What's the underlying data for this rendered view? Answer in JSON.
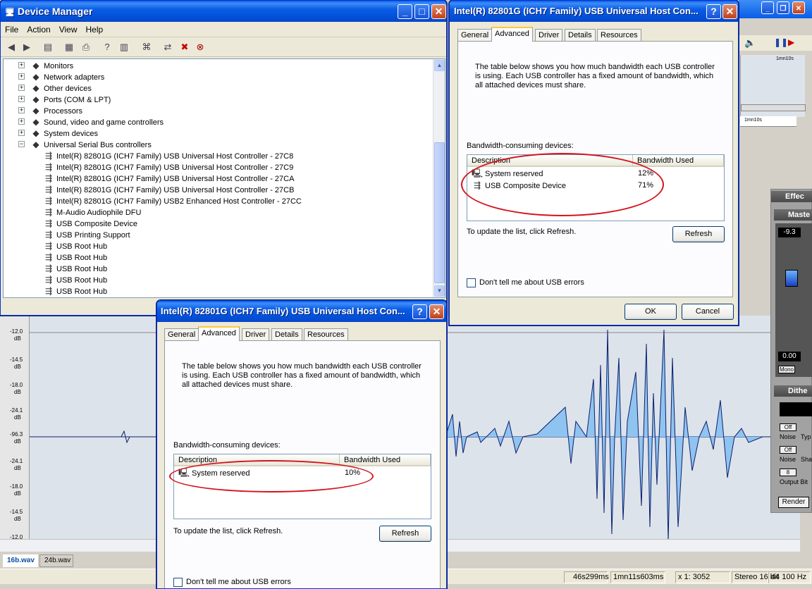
{
  "device_manager": {
    "title": "Device Manager",
    "menu": [
      "File",
      "Action",
      "View",
      "Help"
    ],
    "tree": [
      {
        "label": "Monitors",
        "icon": "monitor-icon",
        "expander": "+"
      },
      {
        "label": "Network adapters",
        "icon": "network-icon",
        "expander": "+"
      },
      {
        "label": "Other devices",
        "icon": "question-icon",
        "expander": "+"
      },
      {
        "label": "Ports (COM & LPT)",
        "icon": "port-icon",
        "expander": "+"
      },
      {
        "label": "Processors",
        "icon": "chip-icon",
        "expander": "+"
      },
      {
        "label": "Sound, video and game controllers",
        "icon": "speaker-icon",
        "expander": "+"
      },
      {
        "label": "System devices",
        "icon": "computer-icon",
        "expander": "+"
      },
      {
        "label": "Universal Serial Bus controllers",
        "icon": "usb-icon",
        "expander": "−"
      }
    ],
    "usb_children": [
      "Intel(R) 82801G (ICH7 Family) USB Universal Host Controller - 27C8",
      "Intel(R) 82801G (ICH7 Family) USB Universal Host Controller - 27C9",
      "Intel(R) 82801G (ICH7 Family) USB Universal Host Controller - 27CA",
      "Intel(R) 82801G (ICH7 Family) USB Universal Host Controller - 27CB",
      "Intel(R) 82801G (ICH7 Family) USB2 Enhanced Host Controller - 27CC",
      "M-Audio Audiophile DFU",
      "USB Composite Device",
      "USB Printing Support",
      "USB Root Hub",
      "USB Root Hub",
      "USB Root Hub",
      "USB Root Hub",
      "USB Root Hub"
    ]
  },
  "dialog_top": {
    "title": "Intel(R) 82801G (ICH7 Family) USB Universal Host Con...",
    "tabs": [
      "General",
      "Advanced",
      "Driver",
      "Details",
      "Resources"
    ],
    "active_tab": "Advanced",
    "description": "The table below shows you how much bandwidth each USB controller is using. Each USB controller has a fixed amount of bandwidth, which all attached devices must share.",
    "devices_label": "Bandwidth-consuming devices:",
    "col_description": "Description",
    "col_bandwidth": "Bandwidth Used",
    "rows": [
      {
        "name": "System reserved",
        "value": "12%"
      },
      {
        "name": "USB Composite Device",
        "value": "71%"
      }
    ],
    "update_hint": "To update the list, click Refresh.",
    "refresh": "Refresh",
    "checkbox": "Don't tell me about USB errors",
    "ok": "OK",
    "cancel": "Cancel"
  },
  "dialog_bottom": {
    "title": "Intel(R) 82801G (ICH7 Family) USB Universal Host Con...",
    "tabs": [
      "General",
      "Advanced",
      "Driver",
      "Details",
      "Resources"
    ],
    "active_tab": "Advanced",
    "description": "The table below shows you how much bandwidth each USB controller is using. Each USB controller has a fixed amount of bandwidth, which all attached devices must share.",
    "devices_label": "Bandwidth-consuming devices:",
    "col_description": "Description",
    "col_bandwidth": "Bandwidth Used",
    "rows": [
      {
        "name": "System reserved",
        "value": "10%"
      }
    ],
    "update_hint": "To update the list, click Refresh.",
    "refresh": "Refresh",
    "checkbox": "Don't tell me about USB errors"
  },
  "audio": {
    "db_labels": [
      "-12.0",
      "dB",
      "-14.5",
      "dB",
      "-18.0",
      "dB",
      "-24.1",
      "dB",
      "-96.3",
      "dB",
      "-24.1",
      "dB",
      "-18.0",
      "dB",
      "-14.5",
      "dB",
      "-12.0"
    ],
    "file_tabs": [
      "16b.wav",
      "24b.wav"
    ],
    "ruler_labels": [
      "1mn10s",
      "1mn10s"
    ],
    "status": [
      "46s299ms",
      "1mn11s603ms",
      "x 1: 3052",
      "Stereo 16 bit",
      "44 100 Hz"
    ],
    "panels": {
      "effects": "Effec",
      "master": "Maste",
      "master_value_top": "-9.3",
      "master_value_bottom": "0.00",
      "mono": "Mono",
      "dither": "Dithe",
      "noise1": "Noise",
      "type": "Typ",
      "noise2": "Noise",
      "shape": "Sha",
      "off1": "Off",
      "off2": "Off",
      "bits": "8",
      "output_bits": "Output Bit",
      "render": "Render"
    }
  },
  "colors": {
    "waveform": "#90c4f0",
    "waveform_line": "#0b1f6e",
    "oval": "#d4141c",
    "title_bar": "#0a5ce6"
  }
}
